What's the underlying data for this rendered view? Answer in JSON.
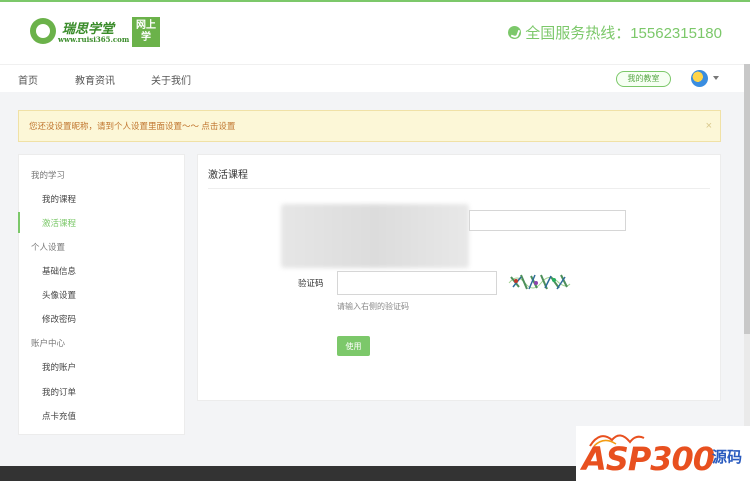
{
  "header": {
    "logo_cn": "瑞思学堂",
    "logo_url": "www.ruisi365.com",
    "logo_box": "网上学",
    "hotline": "全国服务热线：15562315180"
  },
  "nav": {
    "items": [
      "首页",
      "教育资讯",
      "关于我们"
    ],
    "my_class": "我的教室"
  },
  "notice": {
    "text": "您还没设置昵称，请到个人设置里面设置～～ 点击设置",
    "close": "×"
  },
  "sidebar": {
    "group1": "我的学习",
    "my_courses": "我的课程",
    "activate_course": "激活课程",
    "group2": "个人设置",
    "basic_info": "基础信息",
    "avatar_settings": "头像设置",
    "change_password": "修改密码",
    "group3": "账户中心",
    "my_account": "我的账户",
    "my_orders": "我的订单",
    "card_recharge": "点卡充值"
  },
  "main": {
    "title": "激活课程",
    "captcha_label": "验证码",
    "captcha_value": "",
    "captcha_hint": "请输入右侧的验证码",
    "use_button": "使用"
  },
  "watermark": {
    "text": "ASP300",
    "cn": "源码",
    "url": ""
  },
  "colors": {
    "accent": "#7cc86a",
    "notice_bg": "#fcf7d7",
    "notice_text": "#c0752e"
  }
}
